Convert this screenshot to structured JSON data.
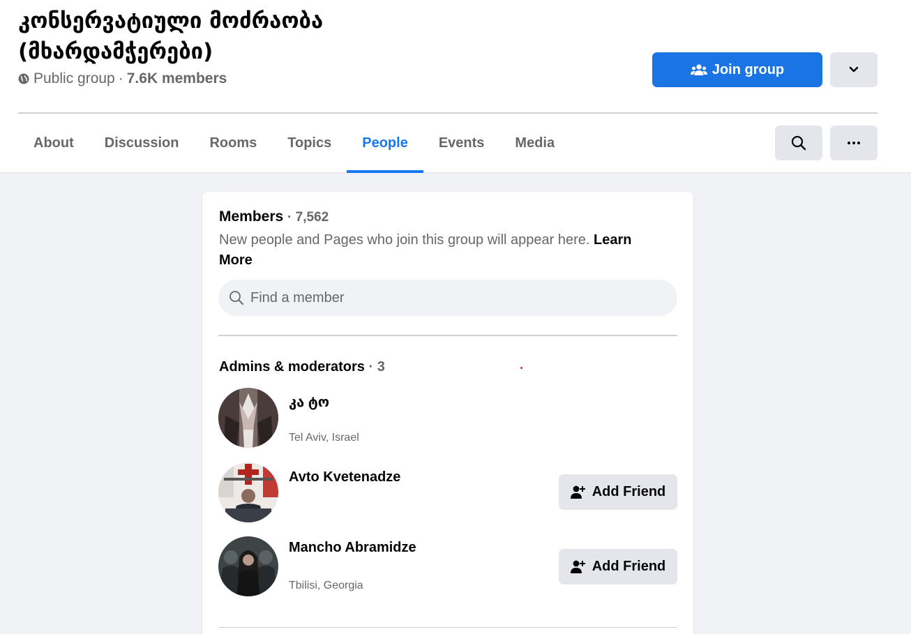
{
  "header": {
    "group_name": "კონსერვატიული მოძრაობა (მხარდამჭერები)",
    "privacy": "Public group",
    "separator": "·",
    "member_count": "7.6K members",
    "join_label": "Join group"
  },
  "tabs": [
    {
      "label": "About"
    },
    {
      "label": "Discussion"
    },
    {
      "label": "Rooms"
    },
    {
      "label": "Topics"
    },
    {
      "label": "People",
      "active": true
    },
    {
      "label": "Events"
    },
    {
      "label": "Media"
    }
  ],
  "members_card": {
    "title": "Members",
    "count": "· 7,562",
    "description": "New people and Pages who join this group will appear here.",
    "learn_more": "Learn More",
    "search_placeholder": "Find a member"
  },
  "admins": {
    "title": "Admins & moderators",
    "count": "· 3",
    "members": [
      {
        "name": "კა ტო",
        "location": "Tel Aviv, Israel",
        "action": ""
      },
      {
        "name": "Avto Kvetenadze",
        "location": "",
        "action": "Add Friend"
      },
      {
        "name": "Mancho Abramidze",
        "location": "Tbilisi, Georgia",
        "action": "Add Friend"
      }
    ]
  },
  "colors": {
    "accent": "#1b74e4",
    "active_tab": "#1877f2",
    "secondary_text": "#65676b",
    "background": "#f0f2f5"
  },
  "icons": {
    "privacy": "globe-icon",
    "join": "group-people-icon",
    "dropdown": "chevron-down-icon",
    "search": "search-icon",
    "more": "more-dots-icon",
    "add_friend": "person-add-icon"
  }
}
